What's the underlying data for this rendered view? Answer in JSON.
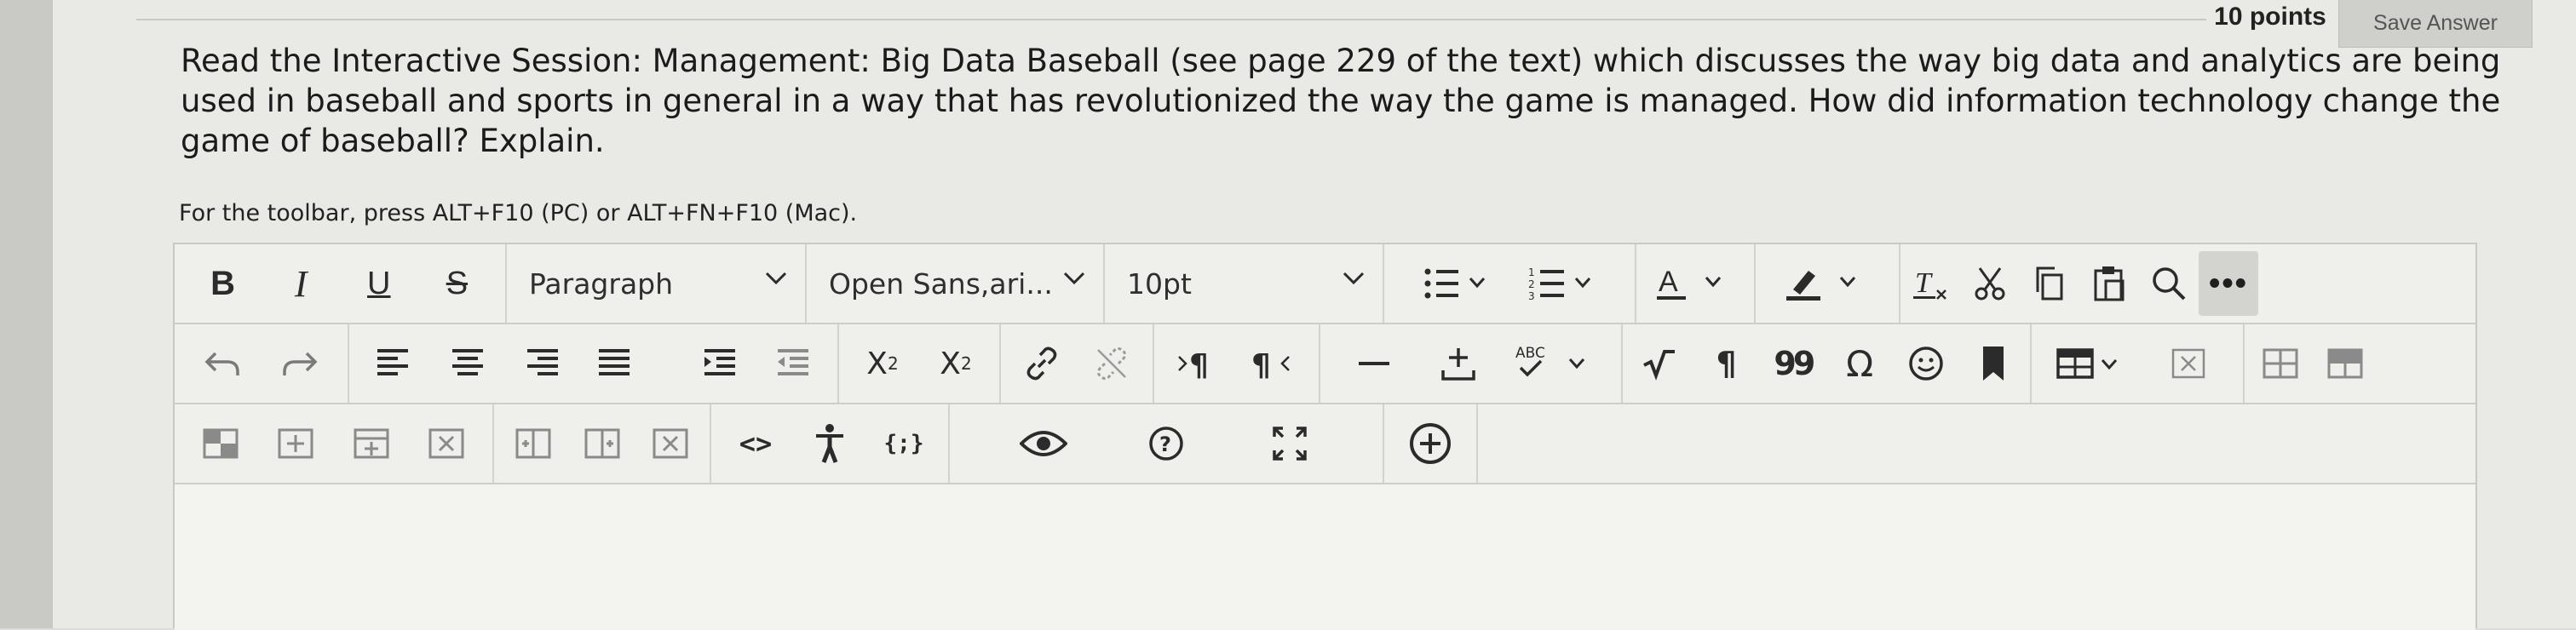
{
  "header": {
    "points": "10 points",
    "save_label": "Save Answer"
  },
  "question": {
    "text": "Read the Interactive Session: Management: Big Data Baseball (see page 229 of the text) which discusses the way big data and analytics are being used in baseball and sports in general in a way that has revolutionized the way the game is managed. How did information technology change the game of baseball? Explain."
  },
  "editor": {
    "toolbar_hint": "For the toolbar, press ALT+F10 (PC) or ALT+FN+F10 (Mac).",
    "format": {
      "bold": "B",
      "italic": "I",
      "underline": "U",
      "strike": "S"
    },
    "block_format": "Paragraph",
    "font_family": "Open Sans,ari...",
    "font_size": "10pt",
    "more": "•••",
    "superscript": "2",
    "subscript": "2",
    "source_code": "<>",
    "template": "{;}",
    "paragraph_mark": "¶",
    "quote": "99",
    "omega": "Ω"
  },
  "colors": {
    "page": "#e9e9e6",
    "toolbar": "#efefec",
    "border": "#c8c8c4",
    "icon": "#2b2b2b"
  }
}
